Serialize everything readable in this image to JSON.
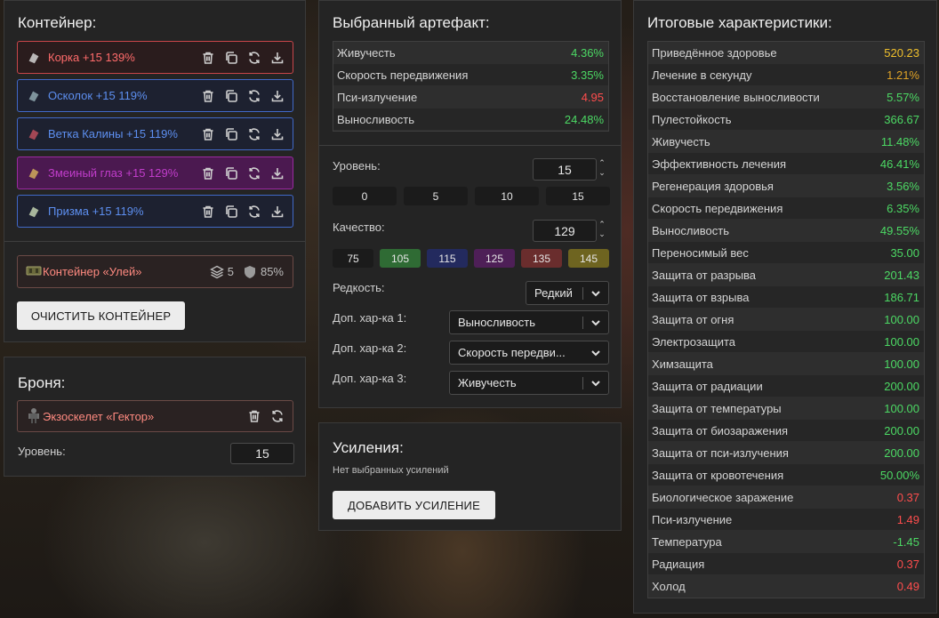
{
  "container": {
    "title": "Контейнер:",
    "artifacts": [
      {
        "name": "Корка +15 139%",
        "rarity": "red",
        "icon": "korka-artifact-icon"
      },
      {
        "name": "Осколок +15 119%",
        "rarity": "blue",
        "icon": "oskolok-artifact-icon"
      },
      {
        "name": "Ветка Калины +15 119%",
        "rarity": "blue",
        "icon": "vetka-kaliny-artifact-icon"
      },
      {
        "name": "Змеиный глаз +15 129%",
        "rarity": "purple",
        "icon": "snake-eye-artifact-icon"
      },
      {
        "name": "Призма +15 119%",
        "rarity": "blue",
        "icon": "prism-artifact-icon"
      }
    ],
    "container_item": {
      "name": "Контейнер «Улей»",
      "slots": "5",
      "protection": "85%"
    },
    "clear_button": "ОЧИСТИТЬ КОНТЕЙНЕР"
  },
  "armor": {
    "title": "Броня:",
    "item": "Экзоскелет «Гектор»",
    "level_label": "Уровень:",
    "level_value": "15"
  },
  "selected": {
    "title": "Выбранный артефакт:",
    "stats": [
      {
        "name": "Живучесть",
        "value": "4.36%",
        "color": "green"
      },
      {
        "name": "Скорость передвижения",
        "value": "3.35%",
        "color": "green"
      },
      {
        "name": "Пси-излучение",
        "value": "4.95",
        "color": "red"
      },
      {
        "name": "Выносливость",
        "value": "24.48%",
        "color": "green"
      }
    ],
    "level_label": "Уровень:",
    "level_value": "15",
    "level_presets": [
      "0",
      "5",
      "10",
      "15"
    ],
    "quality_label": "Качество:",
    "quality_value": "129",
    "quality_presets": [
      {
        "label": "75",
        "color": "#1b1b1b"
      },
      {
        "label": "105",
        "color": "#2f6b34"
      },
      {
        "label": "115",
        "color": "#232a5e"
      },
      {
        "label": "125",
        "color": "#4e1f57"
      },
      {
        "label": "135",
        "color": "#6a2d2d"
      },
      {
        "label": "145",
        "color": "#6e6420"
      }
    ],
    "rarity_label": "Редкость:",
    "rarity_value": "Редкий",
    "extra1_label": "Доп. хар-ка 1:",
    "extra1_value": "Выносливость",
    "extra2_label": "Доп. хар-ка 2:",
    "extra2_value": "Скорость передви...",
    "extra3_label": "Доп. хар-ка 3:",
    "extra3_value": "Живучесть"
  },
  "boosts": {
    "title": "Усиления:",
    "empty_text": "Нет выбранных усилений",
    "add_button": "ДОБАВИТЬ УСИЛЕНИЕ"
  },
  "totals": {
    "title": "Итоговые характеристики:",
    "stats": [
      {
        "name": "Приведённое здоровье",
        "value": "520.23",
        "color": "yellow"
      },
      {
        "name": "Лечение в секунду",
        "value": "1.21%",
        "color": "orange"
      },
      {
        "name": "Восстановление выносливости",
        "value": "5.57%",
        "color": "green"
      },
      {
        "name": "Пулестойкость",
        "value": "366.67",
        "color": "green"
      },
      {
        "name": "Живучесть",
        "value": "11.48%",
        "color": "green"
      },
      {
        "name": "Эффективность лечения",
        "value": "46.41%",
        "color": "green"
      },
      {
        "name": "Регенерация здоровья",
        "value": "3.56%",
        "color": "green"
      },
      {
        "name": "Скорость передвижения",
        "value": "6.35%",
        "color": "green"
      },
      {
        "name": "Выносливость",
        "value": "49.55%",
        "color": "green"
      },
      {
        "name": "Переносимый вес",
        "value": "35.00",
        "color": "green"
      },
      {
        "name": "Защита от разрыва",
        "value": "201.43",
        "color": "green"
      },
      {
        "name": "Защита от взрыва",
        "value": "186.71",
        "color": "green"
      },
      {
        "name": "Защита от огня",
        "value": "100.00",
        "color": "green"
      },
      {
        "name": "Электрозащита",
        "value": "100.00",
        "color": "green"
      },
      {
        "name": "Химзащита",
        "value": "100.00",
        "color": "green"
      },
      {
        "name": "Защита от радиации",
        "value": "200.00",
        "color": "green"
      },
      {
        "name": "Защита от температуры",
        "value": "100.00",
        "color": "green"
      },
      {
        "name": "Защита от биозаражения",
        "value": "200.00",
        "color": "green"
      },
      {
        "name": "Защита от пси-излучения",
        "value": "200.00",
        "color": "green"
      },
      {
        "name": "Защита от кровотечения",
        "value": "50.00%",
        "color": "green"
      },
      {
        "name": "Биологическое заражение",
        "value": "0.37",
        "color": "red"
      },
      {
        "name": "Пси-излучение",
        "value": "1.49",
        "color": "red"
      },
      {
        "name": "Температура",
        "value": "-1.45",
        "color": "green"
      },
      {
        "name": "Радиация",
        "value": "0.37",
        "color": "red"
      },
      {
        "name": "Холод",
        "value": "0.49",
        "color": "red"
      }
    ]
  }
}
